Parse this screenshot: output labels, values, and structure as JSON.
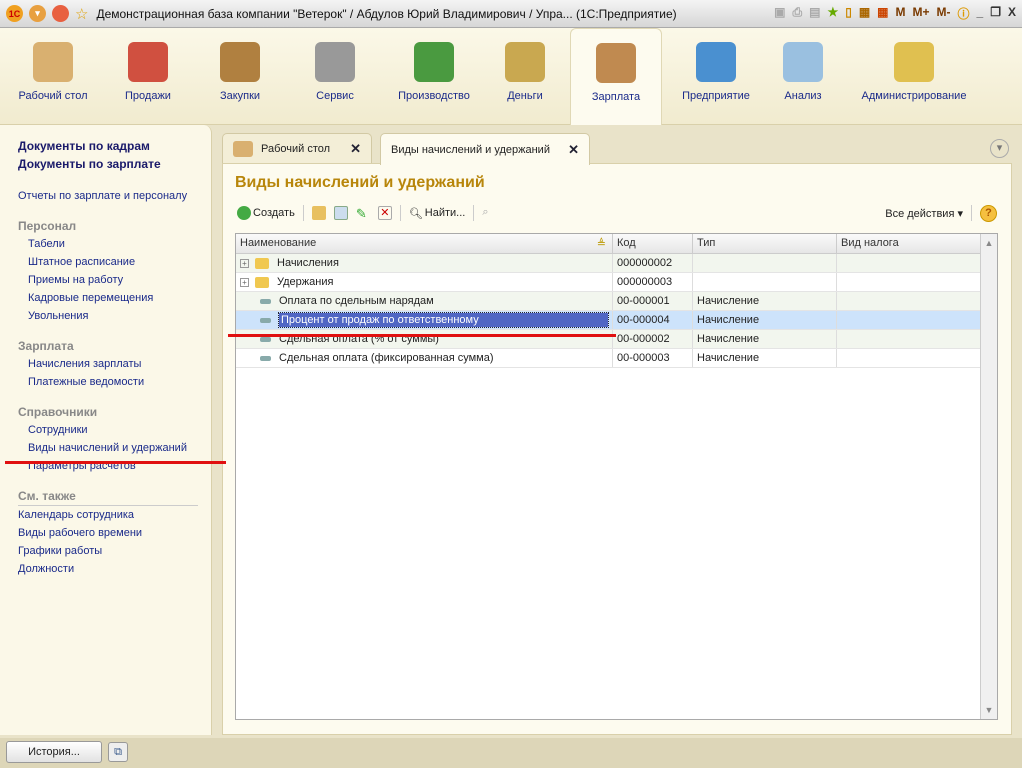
{
  "window": {
    "title": "Демонстрационная база компании \"Ветерок\" / Абдулов Юрий Владимирович / Упра...  (1С:Предприятие)",
    "tools": [
      "M",
      "M+",
      "M-"
    ]
  },
  "sections": [
    {
      "label": "Рабочий стол",
      "icon": "desk-lamp-icon"
    },
    {
      "label": "Продажи",
      "icon": "basket-icon"
    },
    {
      "label": "Закупки",
      "icon": "boxes-cart-icon"
    },
    {
      "label": "Сервис",
      "icon": "tools-icon"
    },
    {
      "label": "Производство",
      "icon": "machine-icon"
    },
    {
      "label": "Деньги",
      "icon": "coins-icon"
    },
    {
      "label": "Зарплата",
      "icon": "worker-coins-icon",
      "active": true
    },
    {
      "label": "Предприятие",
      "icon": "building-icon"
    },
    {
      "label": "Анализ",
      "icon": "chart-icon"
    },
    {
      "label": "Администрирование",
      "icon": "database-computer-icon"
    }
  ],
  "sidebar": {
    "top": [
      "Документы по кадрам",
      "Документы по зарплате"
    ],
    "reports": "Отчеты по зарплате и персоналу",
    "groups": [
      {
        "title": "Персонал",
        "items": [
          "Табели",
          "Штатное расписание",
          "Приемы на работу",
          "Кадровые перемещения",
          "Увольнения"
        ]
      },
      {
        "title": "Зарплата",
        "items": [
          "Начисления зарплаты",
          "Платежные ведомости"
        ]
      },
      {
        "title": "Справочники",
        "items": [
          "Сотрудники",
          "Виды начислений и удержаний",
          "Параметры расчетов"
        ]
      }
    ],
    "see_also": {
      "title": "См. также",
      "items": [
        "Календарь сотрудника",
        "Виды рабочего времени",
        "Графики работы",
        "Должности"
      ]
    }
  },
  "tabs": [
    {
      "label": "Рабочий стол"
    },
    {
      "label": "Виды начислений и удержаний",
      "active": true
    }
  ],
  "form": {
    "title": "Виды начислений и удержаний",
    "toolbar": {
      "create": "Создать",
      "find": "Найти...",
      "all_actions": "Все действия",
      "help": "?"
    },
    "columns": [
      "Наименование",
      "Код",
      "Тип",
      "Вид налога"
    ],
    "rows": [
      {
        "type": "folder",
        "name": "Начисления",
        "code": "000000002",
        "kind": "",
        "tax": ""
      },
      {
        "type": "folder",
        "name": "Удержания",
        "code": "000000003",
        "kind": "",
        "tax": ""
      },
      {
        "type": "item",
        "name": "Оплата по сдельным нарядам",
        "code": "00-000001",
        "kind": "Начисление",
        "tax": ""
      },
      {
        "type": "item",
        "name": "Процент от продаж по ответственному",
        "code": "00-000004",
        "kind": "Начисление",
        "tax": "",
        "selected": true
      },
      {
        "type": "item",
        "name": "Сдельная оплата (% от суммы)",
        "code": "00-000002",
        "kind": "Начисление",
        "tax": ""
      },
      {
        "type": "item",
        "name": "Сдельная оплата (фиксированная сумма)",
        "code": "00-000003",
        "kind": "Начисление",
        "tax": ""
      }
    ]
  },
  "bottom": {
    "history": "История..."
  },
  "colors": {
    "accent_title": "#b8860b",
    "link": "#1a2a8a",
    "selection": "#5066c4",
    "annotation": "#e01010"
  }
}
